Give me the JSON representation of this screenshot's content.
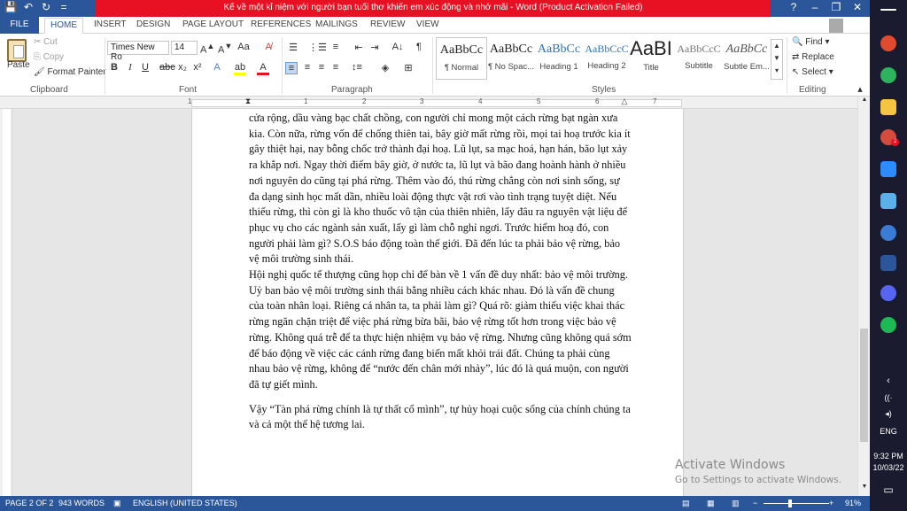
{
  "window": {
    "title": "Kể về một kỉ niệm với người bạn tuổi thơ khiến em xúc động và nhớ mãi - Word (Product Activation Failed)",
    "help": "?",
    "minimize": "–",
    "restore": "❐",
    "close": "✕"
  },
  "qat": {
    "save": "💾",
    "undo": "↶",
    "redo": "↻",
    "customize": "="
  },
  "tabs": [
    "FILE",
    "HOME",
    "INSERT",
    "DESIGN",
    "PAGE LAYOUT",
    "REFERENCES",
    "MAILINGS",
    "REVIEW",
    "VIEW"
  ],
  "clipboard": {
    "paste": "Paste",
    "cut": "Cut",
    "copy": "Copy",
    "format_painter": "Format Painter",
    "label": "Clipboard"
  },
  "font": {
    "name": "Times New Ro",
    "size": "14",
    "label": "Font"
  },
  "paragraph": {
    "label": "Paragraph"
  },
  "styles": {
    "label": "Styles",
    "items": [
      {
        "preview": "AaBbCc",
        "name": "¶ Normal"
      },
      {
        "preview": "AaBbCc",
        "name": "¶ No Spac..."
      },
      {
        "preview": "AaBbCc",
        "name": "Heading 1"
      },
      {
        "preview": "AaBbCcC",
        "name": "Heading 2"
      },
      {
        "preview": "AaBI",
        "name": "Title"
      },
      {
        "preview": "AaBbCcC",
        "name": "Subtitle"
      },
      {
        "preview": "AaBbCc",
        "name": "Subtle Em..."
      }
    ]
  },
  "editing": {
    "find": "Find",
    "replace": "Replace",
    "select": "Select",
    "label": "Editing"
  },
  "ruler_numbers": [
    "1",
    "1",
    "2",
    "3",
    "4",
    "5",
    "6",
    "7"
  ],
  "document": {
    "paragraphs": [
      "cửa rộng, dầu vàng bạc chất chồng, con người chỉ mong một cách rừng bạt ngàn xưa kia. Còn nữa, rừng vốn để chống thiên tai, bây giờ mất rừng rồi, mọi tai hoạ trước kia ít gây thiệt hại, nay bỗng chốc trở thành đại hoạ. Lũ lụt, sa mạc hoá, hạn hán, bão lụt xảy ra khắp nơi. Ngay thời điểm bây giờ, ở nước ta, lũ lụt và bão đang hoành hành ở nhiều nơi nguyên do cũng tại phá rừng. Thêm vào đó, thú rừng chẳng còn nơi sinh sống, sự đa dạng sinh học mất dần, nhiều loài động thực vật rơi vào tình trạng tuyệt diệt. Nếu thiếu rừng, thì còn gì là kho thuốc vô tận của thiên nhiên, lấy đâu ra nguyên vật liệu để phục vụ cho các ngành sản xuất, lấy gì làm chỗ nghỉ ngơi. Trước hiểm hoạ đó, con người phải làm gì? S.O.S báo động toàn thế giới. Đã đến lúc ta phải bảo vệ rừng, bảo vệ môi trường sinh thái.",
      "Hội nghị quốc tế thượng cũng họp chỉ để bàn về 1 vấn đề duy nhất: bảo vệ môi trường. Uỷ ban bảo vệ môi trường sinh thái bằng nhiều cách khác nhau. Đó là vấn đề chung của toàn nhân loại. Riêng cá nhân ta, ta phải làm gì? Quá rõ: giảm thiểu việc khai thác rừng ngăn chặn triệt để việc phá rừng bừa bãi, bảo vệ rừng tốt hơn trong việc bảo vệ rừng. Không quá trễ để ta thực hiện nhiệm vụ bảo vệ rừng. Nhưng cũng không quá sớm để báo động về việc các cánh rừng đang biến mất khỏi trái đất. Chúng ta phải cùng nhau bảo vệ rừng, không để “nước đến chân mới nhảy”, lúc đó là quá muộn, con người đã tự giết mình.",
      "Vậy “Tàn phá rừng chính là tự thất cổ mình”, tự hủy hoại cuộc sống của chính chúng ta và cả một thế hệ tương lai."
    ]
  },
  "watermark": {
    "line1": "Activate Windows",
    "line2": "Go to Settings to activate Windows."
  },
  "status": {
    "page": "PAGE 2 OF 2",
    "words": "943 WORDS",
    "language": "ENGLISH (UNITED STATES)",
    "zoom": "91%"
  },
  "taskbar": {
    "lang": "ENG",
    "time": "9:32 PM",
    "date": "10/03/22",
    "badge": "2"
  },
  "colors": {
    "word_blue": "#2b579a",
    "alert_red": "#e81123"
  }
}
